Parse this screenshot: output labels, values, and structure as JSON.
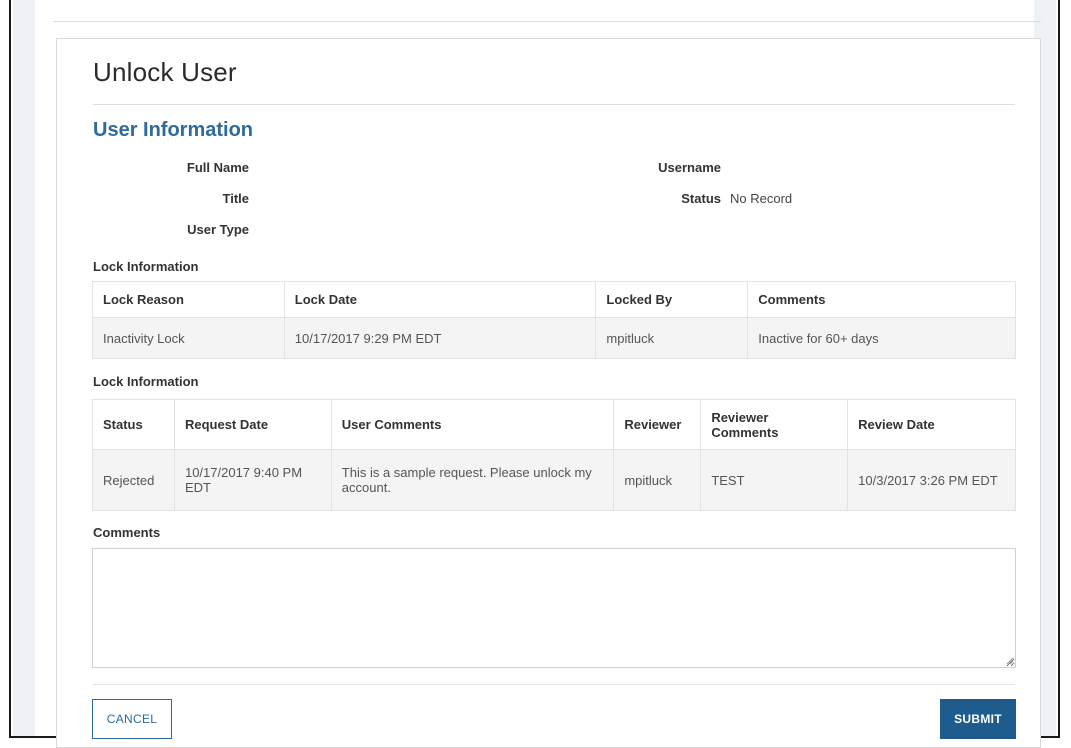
{
  "page": {
    "title": "Unlock User"
  },
  "user_information": {
    "heading": "User Information",
    "full_name_label": "Full Name",
    "full_name_value": "",
    "title_label": "Title",
    "title_value": "",
    "user_type_label": "User Type",
    "user_type_value": "",
    "username_label": "Username",
    "username_value": "",
    "status_label": "Status",
    "status_value": "No Record"
  },
  "lock_information": {
    "heading": "Lock Information",
    "columns": [
      "Lock Reason",
      "Lock Date",
      "Locked By",
      "Comments"
    ],
    "rows": [
      [
        "Inactivity Lock",
        "10/17/2017 9:29 PM EDT",
        "mpitluck",
        "Inactive for 60+ days"
      ]
    ]
  },
  "request_information": {
    "heading": "Lock Information",
    "columns": [
      "Status",
      "Request Date",
      "User Comments",
      "Reviewer",
      "Reviewer Comments",
      "Review Date"
    ],
    "rows": [
      [
        "Rejected",
        "10/17/2017 9:40 PM EDT",
        "This is a sample request. Please unlock my account.",
        "mpitluck",
        "TEST",
        "10/3/2017 3:26 PM EDT"
      ]
    ]
  },
  "comments": {
    "label": "Comments",
    "value": ""
  },
  "actions": {
    "cancel_label": "CANCEL",
    "submit_label": "SUBMIT"
  },
  "colors": {
    "accent": "#2e6b9c",
    "submit_bg": "#1f5c8e"
  }
}
